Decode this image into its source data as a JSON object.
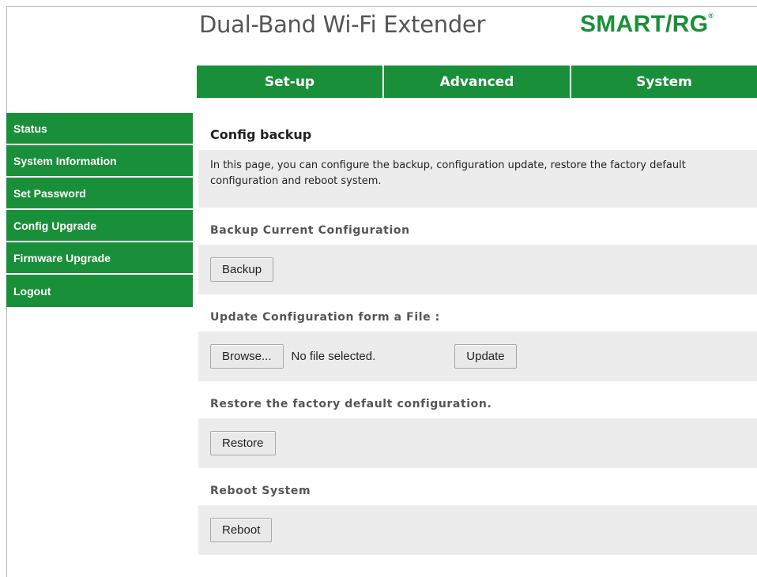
{
  "header": {
    "product_title": "Dual-Band Wi-Fi Extender",
    "logo_text": "SMART/RG",
    "logo_mark": "®",
    "brand_color": "#1a8f3a"
  },
  "topnav": {
    "tabs": [
      {
        "label": "Set-up"
      },
      {
        "label": "Advanced"
      },
      {
        "label": "System"
      }
    ]
  },
  "sidebar": {
    "items": [
      {
        "label": "Status"
      },
      {
        "label": "System Information"
      },
      {
        "label": "Set Password"
      },
      {
        "label": "Config Upgrade"
      },
      {
        "label": "Firmware Upgrade"
      },
      {
        "label": "Logout"
      }
    ]
  },
  "main": {
    "title": "Config backup",
    "description": "In this page, you can configure the backup, configuration update, restore the factory default configuration and reboot system.",
    "backup": {
      "heading": "Backup Current Configuration",
      "button": "Backup"
    },
    "update": {
      "heading": "Update Configuration form a File :",
      "browse_button": "Browse...",
      "file_status": "No file selected.",
      "update_button": "Update"
    },
    "restore": {
      "heading": "Restore the factory default configuration.",
      "button": "Restore"
    },
    "reboot": {
      "heading": "Reboot System",
      "button": "Reboot"
    }
  }
}
